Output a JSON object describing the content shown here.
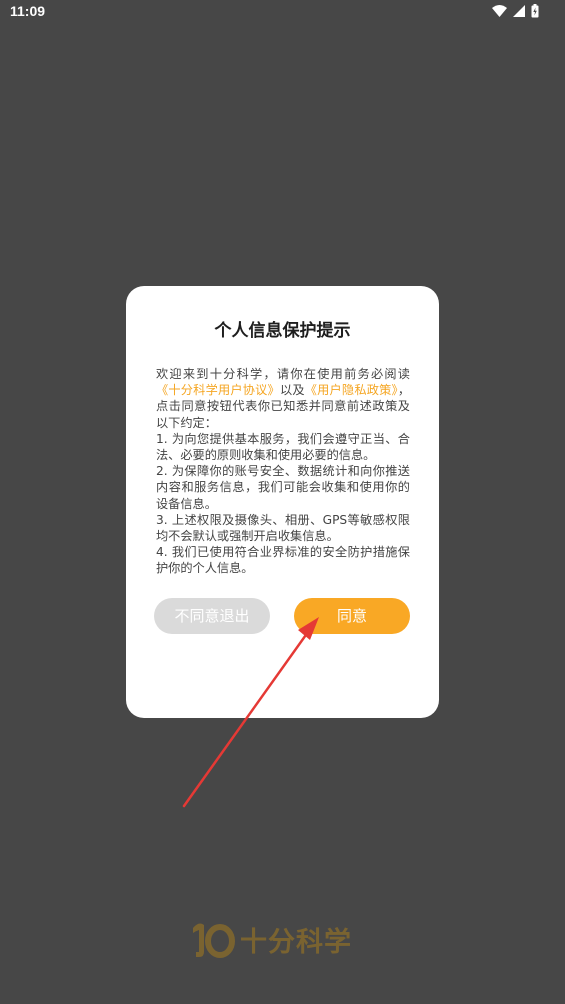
{
  "status_bar": {
    "time": "11:09",
    "icons": [
      "wifi-icon",
      "signal-icon",
      "battery-charging-icon"
    ]
  },
  "dialog": {
    "title": "个人信息保护提示",
    "body": {
      "intro_1": "欢迎来到十分科学，请你在使用前务必阅读",
      "user_agreement_link": "《十分科学用户协议》",
      "intro_2": "以及",
      "privacy_policy_link": "《用户隐私政策》",
      "intro_3": "，点击同意按钮代表你已知悉并同意前述政策及以下约定：",
      "items": [
        "1. 为向您提供基本服务，我们会遵守正当、合法、必要的原则收集和使用必要的信息。",
        "2. 为保障你的账号安全、数据统计和向你推送内容和服务信息，我们可能会收集和使用你的设备信息。",
        "3. 上述权限及摄像头、相册、GPS等敏感权限均不会默认或强制开启收集信息。",
        "4. 我们已使用符合业界标准的安全防护措施保护你的个人信息。"
      ]
    },
    "buttons": {
      "disagree": "不同意退出",
      "agree": "同意"
    }
  },
  "brand": {
    "name": "十分科学"
  },
  "colors": {
    "overlay": "#474747",
    "accent": "#f9a825",
    "link": "#f5a623",
    "arrow": "#e53935",
    "brand": "#7a6330"
  }
}
